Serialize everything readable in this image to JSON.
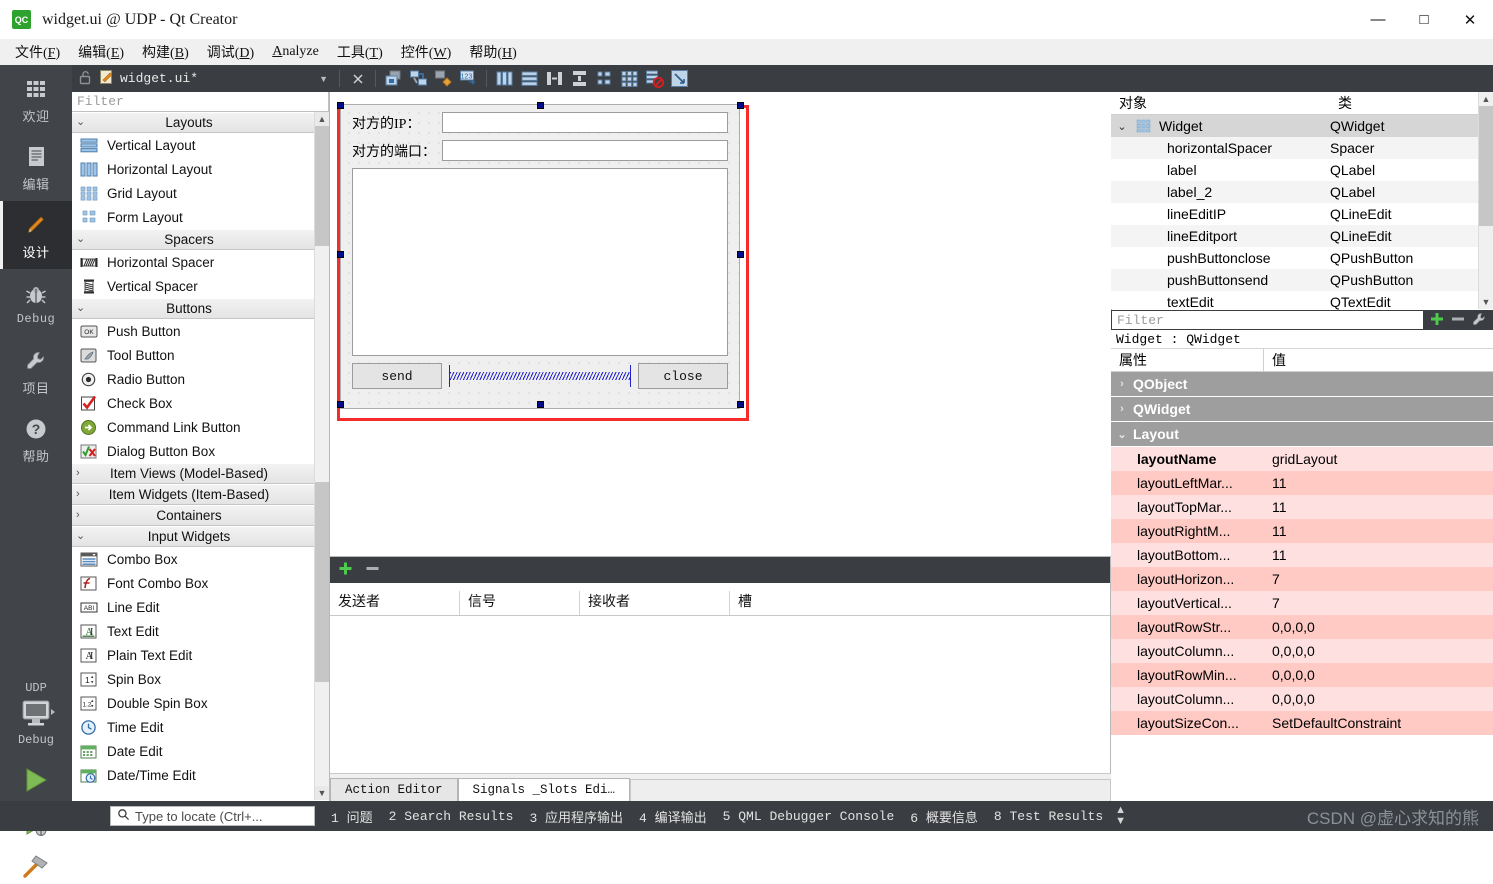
{
  "window": {
    "title": "widget.ui @ UDP - Qt Creator",
    "logo_text": "QC",
    "minimize": "—",
    "maximize": "□",
    "close": "✕"
  },
  "menubar": [
    {
      "label": "文件(F)"
    },
    {
      "label": "编辑(E)"
    },
    {
      "label": "构建(B)"
    },
    {
      "label": "调试(D)"
    },
    {
      "label": "Analyze"
    },
    {
      "label": "工具(T)"
    },
    {
      "label": "控件(W)"
    },
    {
      "label": "帮助(H)"
    }
  ],
  "modebar": {
    "modes": [
      {
        "label": "欢迎",
        "icon": "grid-icon"
      },
      {
        "label": "编辑",
        "icon": "document-icon"
      },
      {
        "label": "设计",
        "icon": "pencil-icon"
      },
      {
        "label": "Debug",
        "icon": "bug-icon"
      },
      {
        "label": "项目",
        "icon": "wrench-icon"
      },
      {
        "label": "帮助",
        "icon": "question-icon"
      }
    ],
    "kit_name": "UDP",
    "kit_config": "Debug"
  },
  "editor_toolbar": {
    "filename": "widget.ui*",
    "lock_icon": "unlocked-icon",
    "file_icon": "ui-file-icon",
    "dropdown_icon": "chevron-down-icon",
    "close_icon": "close-icon",
    "tools": [
      "edit-widgets-icon",
      "edit-signals-slots-icon",
      "edit-buddies-icon",
      "edit-tab-order-icon",
      "layout-horizontally-icon",
      "layout-vertically-icon",
      "layout-splitter-h-icon",
      "layout-splitter-v-icon",
      "layout-form-icon",
      "layout-grid-icon",
      "break-layout-icon",
      "adjust-size-icon"
    ]
  },
  "widget_box": {
    "filter_placeholder": "Filter",
    "categories": [
      {
        "name": "Layouts",
        "expanded": true,
        "items": [
          {
            "label": "Vertical Layout",
            "icon": "vertical-layout-icon"
          },
          {
            "label": "Horizontal Layout",
            "icon": "horizontal-layout-icon"
          },
          {
            "label": "Grid Layout",
            "icon": "grid-layout-icon"
          },
          {
            "label": "Form Layout",
            "icon": "form-layout-icon"
          }
        ]
      },
      {
        "name": "Spacers",
        "expanded": true,
        "items": [
          {
            "label": "Horizontal Spacer",
            "icon": "horizontal-spacer-icon"
          },
          {
            "label": "Vertical Spacer",
            "icon": "vertical-spacer-icon"
          }
        ]
      },
      {
        "name": "Buttons",
        "expanded": true,
        "items": [
          {
            "label": "Push Button",
            "icon": "push-button-icon"
          },
          {
            "label": "Tool Button",
            "icon": "tool-button-icon"
          },
          {
            "label": "Radio Button",
            "icon": "radio-button-icon"
          },
          {
            "label": "Check Box",
            "icon": "check-box-icon"
          },
          {
            "label": "Command Link Button",
            "icon": "command-link-button-icon"
          },
          {
            "label": "Dialog Button Box",
            "icon": "dialog-button-box-icon"
          }
        ]
      },
      {
        "name": "Item Views (Model-Based)",
        "expanded": false,
        "items": []
      },
      {
        "name": "Item Widgets (Item-Based)",
        "expanded": false,
        "items": []
      },
      {
        "name": "Containers",
        "expanded": false,
        "items": []
      },
      {
        "name": "Input Widgets",
        "expanded": true,
        "items": [
          {
            "label": "Combo Box",
            "icon": "combo-box-icon"
          },
          {
            "label": "Font Combo Box",
            "icon": "font-combo-box-icon"
          },
          {
            "label": "Line Edit",
            "icon": "line-edit-icon"
          },
          {
            "label": "Text Edit",
            "icon": "text-edit-icon"
          },
          {
            "label": "Plain Text Edit",
            "icon": "plain-text-edit-icon"
          },
          {
            "label": "Spin Box",
            "icon": "spin-box-icon"
          },
          {
            "label": "Double Spin Box",
            "icon": "double-spin-box-icon"
          },
          {
            "label": "Time Edit",
            "icon": "time-edit-icon"
          },
          {
            "label": "Date Edit",
            "icon": "date-edit-icon"
          },
          {
            "label": "Date/Time Edit",
            "icon": "date-time-edit-icon"
          }
        ]
      }
    ]
  },
  "form": {
    "label_ip": "对方的IP：",
    "label_port": "对方的端口：",
    "value_ip": "",
    "value_port": "",
    "text_edit_value": "",
    "button_send": "send",
    "button_close": "close",
    "selection_color": "#f42c2c",
    "handle_color": "#000c8c"
  },
  "signals_slots": {
    "add_icon": "plus-icon",
    "remove_icon": "minus-icon",
    "columns": [
      "发送者",
      "信号",
      "接收者",
      "槽"
    ],
    "rows": [],
    "tabs": [
      {
        "label": "Action Editor",
        "active": false
      },
      {
        "label": "Signals _Slots Edi…",
        "active": true
      }
    ]
  },
  "object_inspector": {
    "columns": [
      "对象",
      "类"
    ],
    "rows": [
      {
        "name": "Widget",
        "class": "QWidget",
        "indent": 0,
        "expanded": true,
        "selected": true,
        "icon": "grid-layout-icon"
      },
      {
        "name": "horizontalSpacer",
        "class": "Spacer",
        "indent": 1,
        "selected": false
      },
      {
        "name": "label",
        "class": "QLabel",
        "indent": 1,
        "selected": false
      },
      {
        "name": "label_2",
        "class": "QLabel",
        "indent": 1,
        "selected": false
      },
      {
        "name": "lineEditIP",
        "class": "QLineEdit",
        "indent": 1,
        "selected": false
      },
      {
        "name": "lineEditport",
        "class": "QLineEdit",
        "indent": 1,
        "selected": false
      },
      {
        "name": "pushButtonclose",
        "class": "QPushButton",
        "indent": 1,
        "selected": false
      },
      {
        "name": "pushButtonsend",
        "class": "QPushButton",
        "indent": 1,
        "selected": false
      },
      {
        "name": "textEdit",
        "class": "QTextEdit",
        "indent": 1,
        "selected": false
      }
    ]
  },
  "property_editor": {
    "filter_placeholder": "Filter",
    "object_line": "Widget : QWidget",
    "columns": [
      "属性",
      "值"
    ],
    "actions": [
      "plus-icon",
      "minus-icon",
      "configure-icon"
    ],
    "groups": [
      {
        "name": "QObject",
        "expanded": false,
        "rows": []
      },
      {
        "name": "QWidget",
        "expanded": false,
        "rows": []
      },
      {
        "name": "Layout",
        "expanded": true,
        "rows": [
          {
            "name": "layoutName",
            "value": "gridLayout",
            "bold": true
          },
          {
            "name": "layoutLeftMar...",
            "value": "11"
          },
          {
            "name": "layoutTopMar...",
            "value": "11"
          },
          {
            "name": "layoutRightM...",
            "value": "11"
          },
          {
            "name": "layoutBottom...",
            "value": "11"
          },
          {
            "name": "layoutHorizon...",
            "value": "7"
          },
          {
            "name": "layoutVertical...",
            "value": "7"
          },
          {
            "name": "layoutRowStr...",
            "value": "0,0,0,0"
          },
          {
            "name": "layoutColumn...",
            "value": "0,0,0,0"
          },
          {
            "name": "layoutRowMin...",
            "value": "0,0,0,0"
          },
          {
            "name": "layoutColumn...",
            "value": "0,0,0,0"
          },
          {
            "name": "layoutSizeCon...",
            "value": "SetDefaultConstraint"
          }
        ]
      }
    ]
  },
  "statusbar": {
    "locator_placeholder": "Type to locate (Ctrl+...",
    "search_icon": "search-icon",
    "panes": [
      "1 问题",
      "2 Search Results",
      "3 应用程序输出",
      "4 编译输出",
      "5 QML Debugger Console",
      "6 概要信息",
      "8 Test Results"
    ],
    "watermark": "CSDN @虚心求知的熊"
  }
}
